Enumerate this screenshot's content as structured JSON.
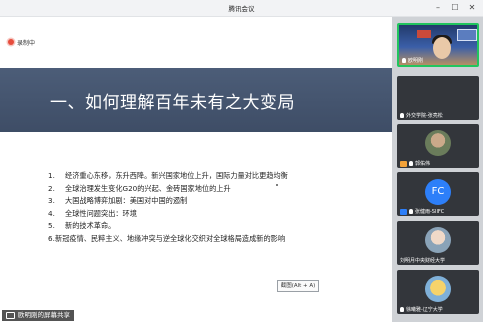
{
  "window": {
    "title": "腾讯会议"
  },
  "recording": {
    "label": "录制中"
  },
  "slide": {
    "heading": "一、如何理解百年未有之大变局",
    "items": [
      {
        "num": "1.",
        "text": "经济重心东移，东升西降。新兴国家地位上升，国际力量对比更趋均衡"
      },
      {
        "num": "2.",
        "text": "全球治理发生变化G20的兴起、金砖国家地位的上升"
      },
      {
        "num": "3.",
        "text": "大国战略博弈加剧：美国对中国的遏制"
      },
      {
        "num": "4.",
        "text": "全球性问题突出：环境"
      },
      {
        "num": "5.",
        "text": "新的技术革命。"
      },
      {
        "num": "6.",
        "text": "新冠疫情、民粹主义、地缘冲突与逆全球化交织对全球格局造成新的影响"
      }
    ]
  },
  "screenshot_hint": "截图(Alt + A)",
  "share": {
    "label": "欧明刚的屏幕共享"
  },
  "participants": [
    {
      "name": "欧明刚",
      "kind": "video",
      "active": true
    },
    {
      "name": "外交学院-张亮松",
      "kind": "muted"
    },
    {
      "name": "郭佑伟",
      "kind": "photo",
      "badge": "user"
    },
    {
      "name": "张健雨-SIIFC",
      "kind": "initials",
      "initials": "FC",
      "badge": "user-blue"
    },
    {
      "name": "刘明月中央财经大学",
      "kind": "photo"
    },
    {
      "name": "徐曦雅-辽宁大学",
      "kind": "photo"
    }
  ],
  "colors": {
    "slide_banner": "#45556f",
    "panel_bg": "#cfd2d6",
    "active_border": "#22c55e",
    "recording_red": "#e74c3c"
  }
}
